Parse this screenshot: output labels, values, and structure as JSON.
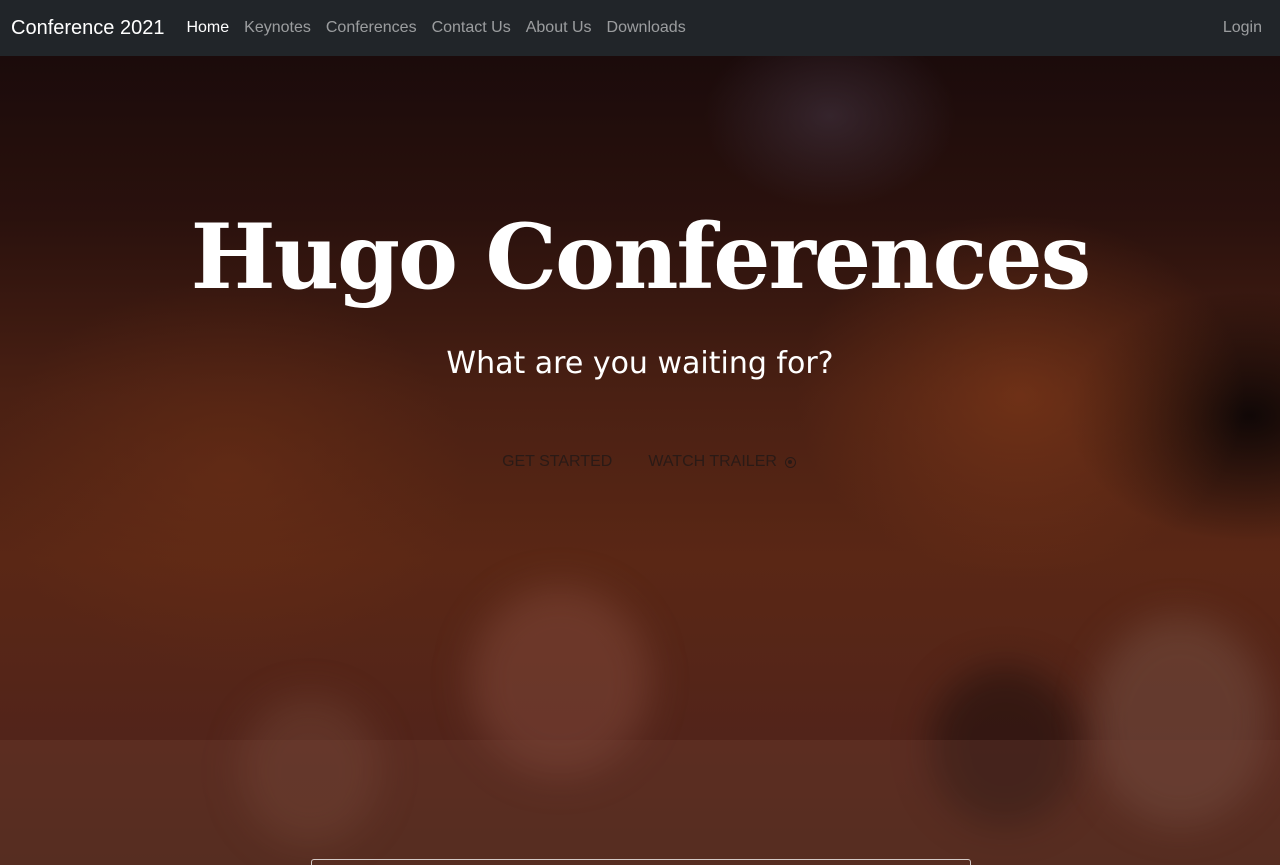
{
  "navbar": {
    "brand": "Conference 2021",
    "links": [
      {
        "label": "Home",
        "active": true
      },
      {
        "label": "Keynotes"
      },
      {
        "label": "Conferences"
      },
      {
        "label": "Contact Us"
      },
      {
        "label": "About Us"
      },
      {
        "label": "Downloads"
      }
    ],
    "login": "Login"
  },
  "hero": {
    "title": "Hugo Conferences",
    "subtitle": "What are you waiting for?",
    "get_started": "GET STARTED",
    "watch_trailer": "WATCH TRAILER",
    "trailer_icon": "play-circle-icon"
  },
  "colors": {
    "navbar_bg": "#212529",
    "hero_text": "#ffffff"
  }
}
